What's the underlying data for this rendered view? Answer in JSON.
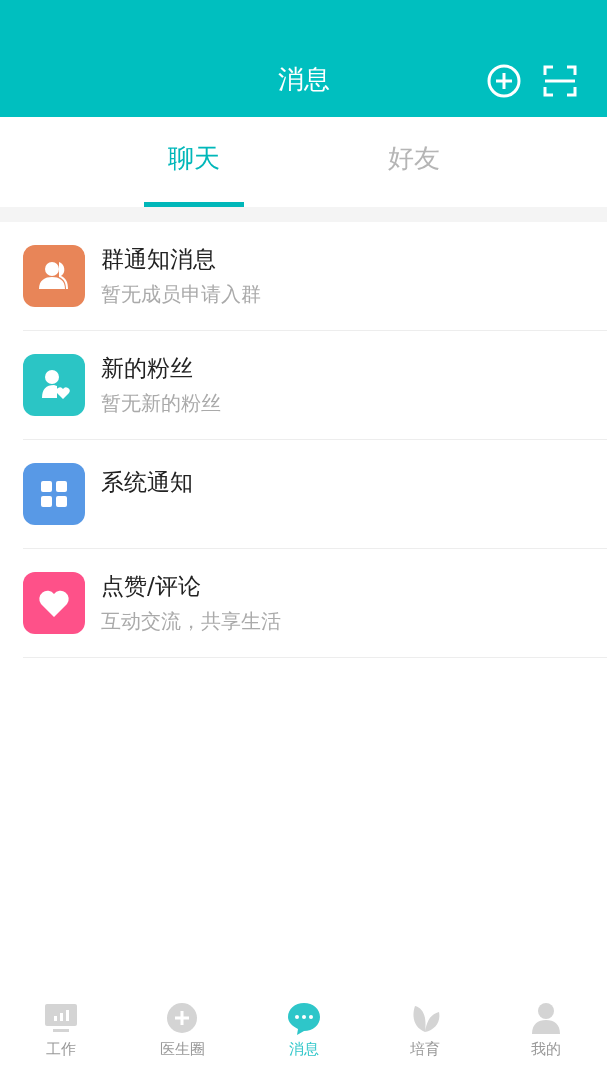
{
  "header": {
    "title": "消息"
  },
  "tabs": [
    {
      "label": "聊天",
      "selected": true
    },
    {
      "label": "好友",
      "selected": false
    }
  ],
  "messages": [
    {
      "kind": "group",
      "title": "群通知消息",
      "subtitle": "暂无成员申请入群",
      "color": "#e88558"
    },
    {
      "kind": "fans",
      "title": "新的粉丝",
      "subtitle": "暂无新的粉丝",
      "color": "#2bc5c5"
    },
    {
      "kind": "system",
      "title": "系统通知",
      "color": "#5899e6"
    },
    {
      "kind": "likes",
      "title": "点赞/评论",
      "subtitle": "互动交流，共享生活",
      "color": "#fe5189"
    }
  ],
  "bottom_nav": [
    {
      "kind": "work",
      "label": "工作",
      "selected": false
    },
    {
      "kind": "circle",
      "label": "医生圈",
      "selected": false
    },
    {
      "kind": "message",
      "label": "消息",
      "selected": true
    },
    {
      "kind": "grow",
      "label": "培育",
      "selected": false
    },
    {
      "kind": "me",
      "label": "我的",
      "selected": false
    }
  ]
}
